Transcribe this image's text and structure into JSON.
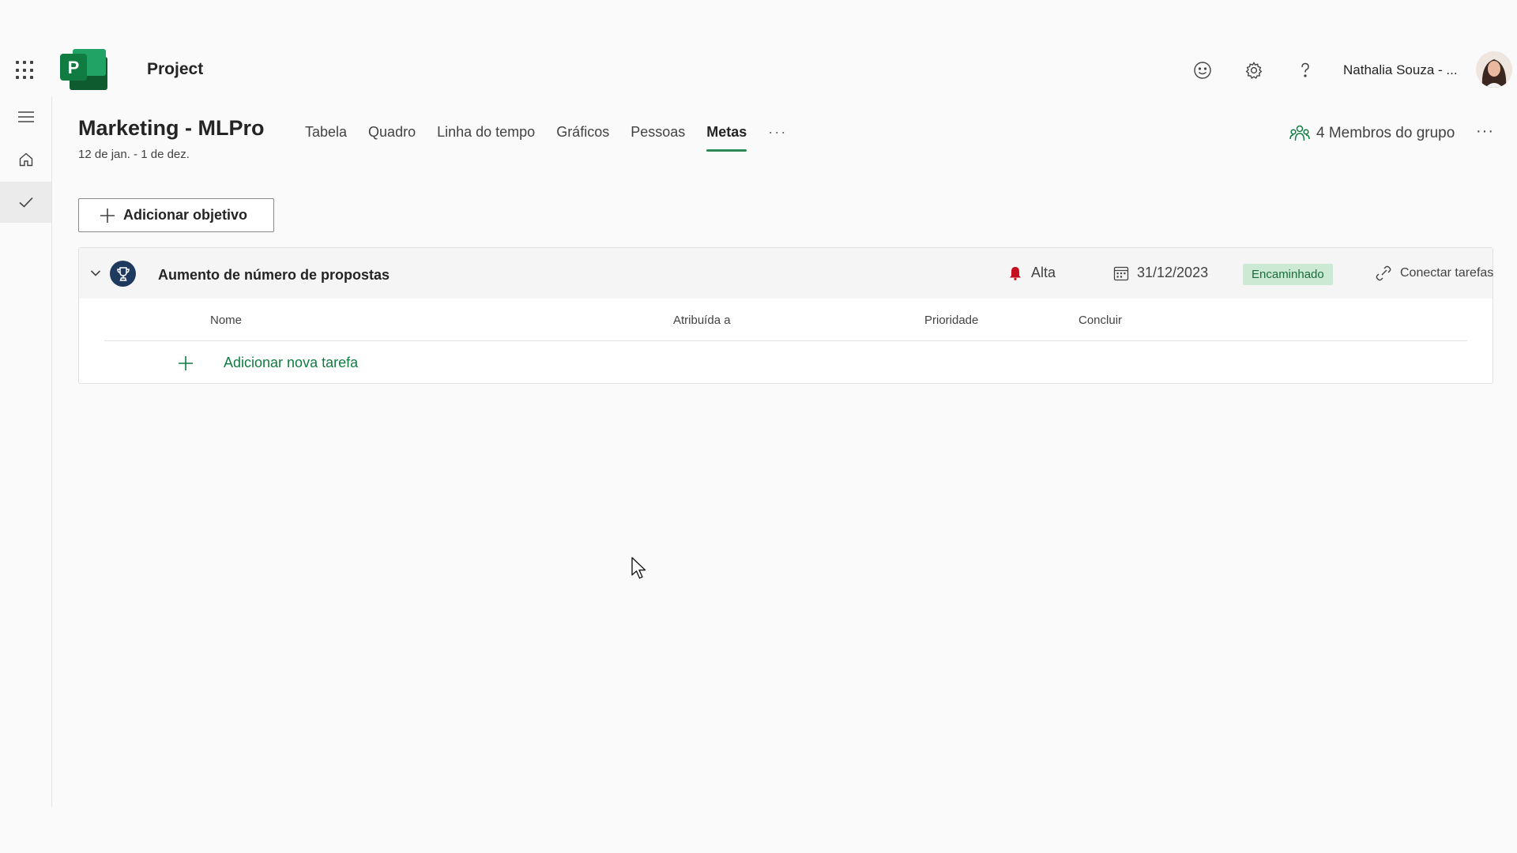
{
  "header": {
    "app_name": "Project",
    "user_name": "Nathalia Souza - ..."
  },
  "plan": {
    "title": "Marketing - MLPro",
    "dates": "12 de jan. - 1 de dez.",
    "tabs": [
      {
        "label": "Tabela"
      },
      {
        "label": "Quadro"
      },
      {
        "label": "Linha do tempo"
      },
      {
        "label": "Gráficos"
      },
      {
        "label": "Pessoas"
      },
      {
        "label": "Metas",
        "active": true
      }
    ],
    "more_tabs": "···",
    "members_label": "4 Membros do grupo",
    "more_options": "···"
  },
  "toolbar": {
    "add_objective_label": "Adicionar objetivo"
  },
  "goal": {
    "name": "Aumento de número de propostas",
    "priority": "Alta",
    "due_date": "31/12/2023",
    "status": "Encaminhado",
    "connect_label": "Conectar tarefas",
    "columns": [
      "Nome",
      "Atribuída a",
      "Prioridade",
      "Concluir"
    ],
    "add_task_label": "Adicionar nova tarefa"
  },
  "colors": {
    "brand_green": "#107c41",
    "status_bg": "#cce9d4",
    "priority_red": "#c50f1f",
    "trophy_bg": "#1f3a5f"
  },
  "icons": {
    "app_launcher": "waffle-icon",
    "feedback": "smiley-icon",
    "settings": "gear-icon",
    "help": "question-icon",
    "rail": [
      "hamburger-icon",
      "home-icon",
      "checkmark-icon"
    ],
    "members": "group-icon",
    "priority": "bell-icon",
    "due": "calendar-icon",
    "connect": "link-icon",
    "goal": "trophy-icon"
  }
}
